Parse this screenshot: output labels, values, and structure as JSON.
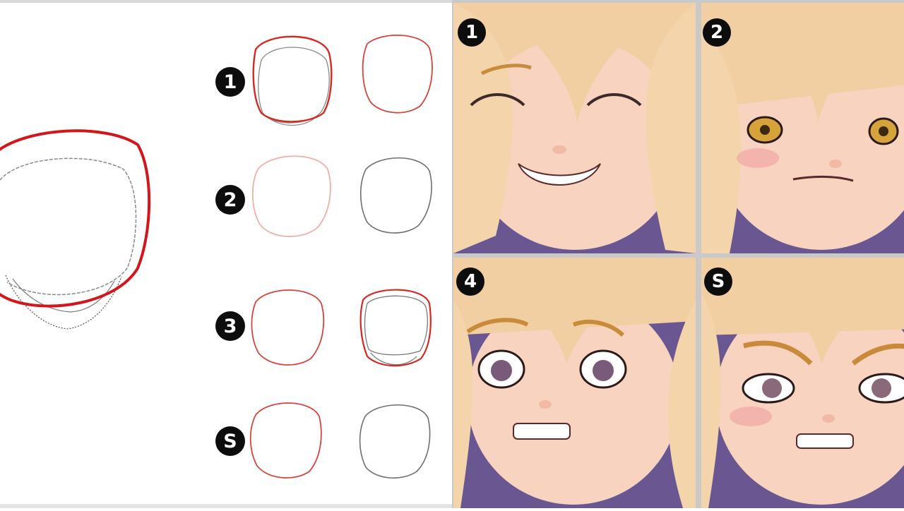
{
  "tutorial": {
    "step_badges": [
      "1",
      "2",
      "3",
      "S"
    ],
    "expression_badges": [
      "1",
      "2",
      "4",
      "S"
    ]
  },
  "colors": {
    "guide_red": "#d4151b",
    "outline_red": "#d8443b",
    "outline_pink": "#f0b0a8",
    "outline_gray": "#6f6f6f",
    "skin": "#f7d3c0",
    "hair": "#f1cfa2",
    "background_purple": "#6a5690"
  }
}
